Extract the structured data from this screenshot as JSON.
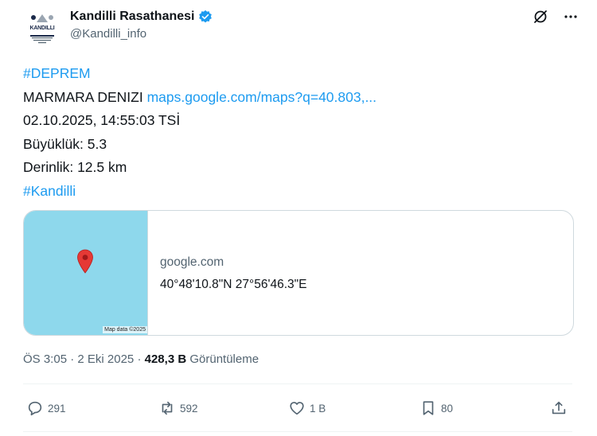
{
  "author": {
    "name": "Kandilli Rasathanesi",
    "handle": "@Kandilli_info",
    "logo_text": "KANDILLI",
    "logo_subtext": "RASATHANESI VE DEPREM ARAŞTIRMA ENSTİTÜSÜ",
    "verified_color": "#1d9bf0"
  },
  "tweet": {
    "hashtag1": "#DEPREM",
    "location_label": "MARMARA DENIZI",
    "maps_link": "maps.google.com/maps?q=40.803,...",
    "datetime": "02.10.2025, 14:55:03 TSİ",
    "magnitude": "Büyüklük: 5.3",
    "depth": "Derinlik: 12.5 km",
    "hashtag2": "#Kandilli"
  },
  "card": {
    "domain": "google.com",
    "title": "40°48'10.8\"N 27°56'46.3\"E",
    "map_attribution": "Map data ©2025"
  },
  "meta": {
    "time": "ÖS 3:05",
    "date": "2 Eki 2025",
    "separator": "·",
    "views_count": "428,3 B",
    "views_label": "Görüntüleme"
  },
  "actions": {
    "replies": "291",
    "reposts": "592",
    "likes": "1 B",
    "bookmarks": "80"
  },
  "colors": {
    "link": "#1d9bf0",
    "secondary_text": "#536471",
    "map_water": "#8ed8ec",
    "pin": "#e53935"
  }
}
